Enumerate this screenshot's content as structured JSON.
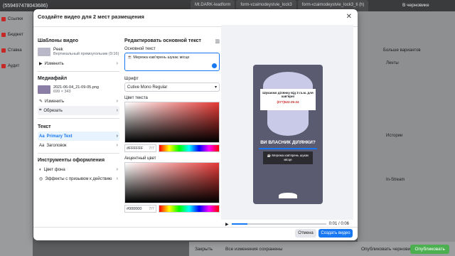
{
  "background": {
    "top_text": "(559497478043686)",
    "tabs": [
      "Mt.DARK-leadform",
      "form-vzaimodeystvie_lock3",
      "form-vzaimodeystvie_lock3_ti (h)"
    ],
    "status": "В черновике",
    "left_rows": [
      "Ссылки",
      "Бюджет",
      "Ставка",
      "Аудит"
    ],
    "right_labels": {
      "more": "Больше вариантов",
      "feeds": "Ленты",
      "stories": "Истории",
      "instream": "In-Stream"
    },
    "footer": {
      "close": "Закрыть",
      "saved": "Все изменения сохранены",
      "publish_drafts": "Опубликовать черновик",
      "publish": "Опубликовать"
    }
  },
  "modal": {
    "title": "Создайте видео для 2 мест размещения",
    "templates": {
      "title": "Шаблоны видео",
      "name": "Peek",
      "desc": "Вертикальный прямоугольник (9:16)",
      "change": "Изменить"
    },
    "media": {
      "title": "Медиафайл",
      "file": "2021-06-04_21-09-05.png",
      "size": "699 × 343",
      "change": "Изменить",
      "crop": "Обрезать"
    },
    "text": {
      "title": "Текст",
      "primary": "Primary Text",
      "heading": "Заголовок"
    },
    "tools": {
      "title": "Инструменты оформления",
      "bg": "Цвет фона",
      "effects": "Эффекты с призывом к действию"
    },
    "edit": {
      "title": "Редактировать основной текст",
      "main_label": "Основной текст",
      "main_value": "Мережа кав'ярень шукає місце",
      "font_label": "Шрифт",
      "font_value": "Cutive Mono Regular",
      "text_color_label": "Цвет текста",
      "text_color": "#FFFFFF",
      "text_count": "7/7",
      "accent_label": "Акцентный цвет",
      "accent_color": "#000000",
      "accent_count": "7/7"
    },
    "preview": {
      "banner": "Шукаємо ділянку від 3 га.м. для кав'ярні",
      "phone": "(077)522-25-24",
      "headline": "ВИ ВЛАСНИК ДІЛЯНКИ?",
      "caption": "Мережа кав'ярень шукає місце",
      "time": "0:01 / 0:06",
      "progress": 0.17
    },
    "buttons": {
      "cancel": "Отмена",
      "create": "Создать видео"
    }
  },
  "colors": {
    "accent": "#1877f2"
  }
}
